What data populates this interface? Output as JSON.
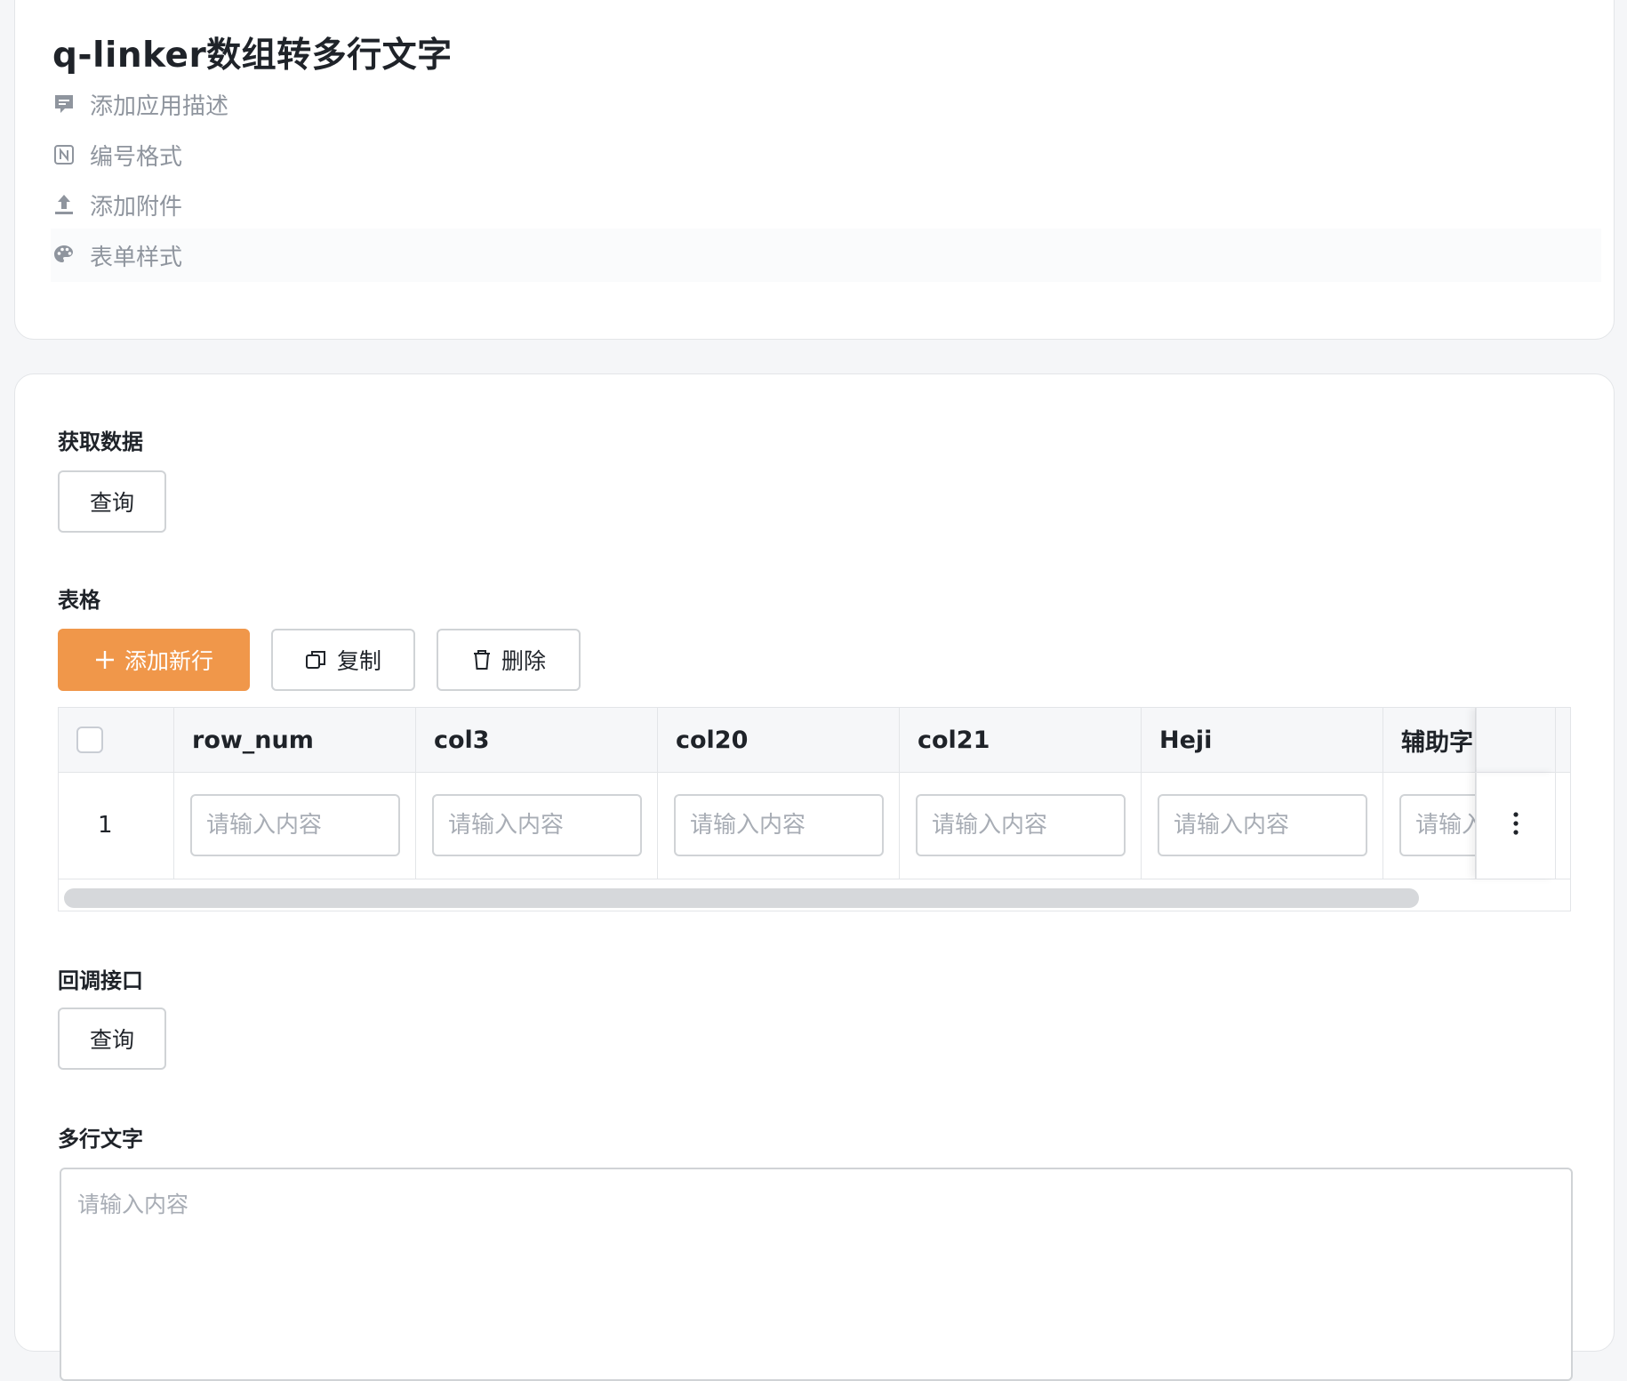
{
  "app": {
    "title": "q-linker数组转多行文字",
    "meta_items": [
      {
        "label": "添加应用描述",
        "icon": "comment-icon"
      },
      {
        "label": "编号格式",
        "icon": "number-format-icon"
      },
      {
        "label": "添加附件",
        "icon": "upload-icon"
      },
      {
        "label": "表单样式",
        "icon": "palette-icon"
      }
    ]
  },
  "sections": {
    "fetch": {
      "label": "获取数据",
      "button": "查询"
    },
    "table": {
      "label": "表格",
      "toolbar": {
        "add": "添加新行",
        "copy": "复制",
        "delete": "删除"
      },
      "columns": [
        "row_num",
        "col3",
        "col20",
        "col21",
        "Heji",
        "辅助字"
      ],
      "rows": [
        {
          "index": "1"
        }
      ],
      "cell_placeholder": "请输入内容",
      "cell_placeholder_partial": "请输入"
    },
    "callback": {
      "label": "回调接口",
      "button": "查询"
    },
    "multiline": {
      "label": "多行文字",
      "placeholder": "请输入内容"
    }
  },
  "colors": {
    "primary": "#f0974a",
    "border": "#d0d3d6",
    "placeholder": "#a8adb5",
    "muted": "#8f959e"
  }
}
